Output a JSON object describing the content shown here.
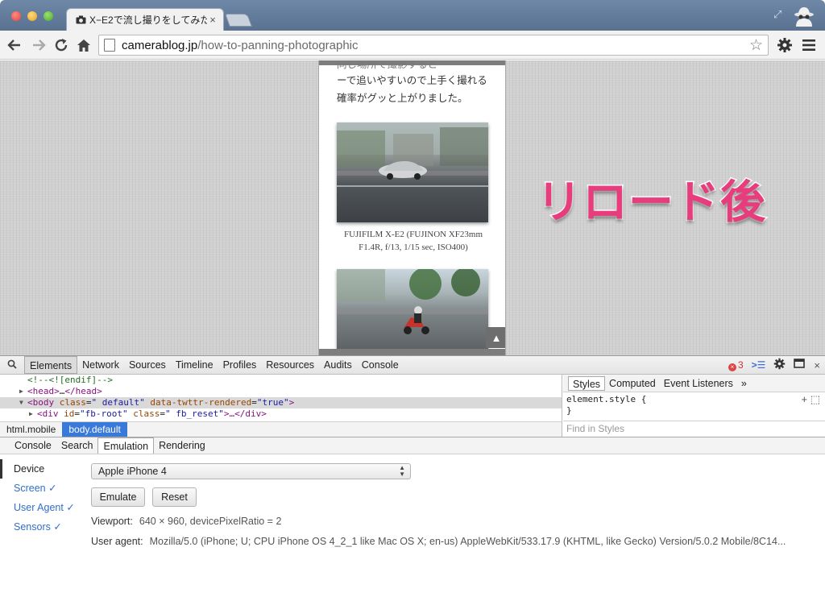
{
  "browser": {
    "tab_title": "X−E2で流し撮りをしてみた",
    "tab_close": "×",
    "url_host": "camerablog.jp",
    "url_path": "/how-to-panning-photographic"
  },
  "page": {
    "partial_line": "同じ場所で撮影すると",
    "line1": "ーで追いやすいので上手く撮れる",
    "line2": "確率がグッと上がりました。",
    "caption_line1": "FUJIFILM X-E2 (FUJINON XF23mm",
    "caption_line2": "F1.4R, f/13, 1/15 sec, ISO400)",
    "scroll_top_glyph": "▲"
  },
  "overlay": {
    "text": "リロード後",
    "color": "#e83c7d"
  },
  "devtools": {
    "tabs": [
      "Elements",
      "Network",
      "Sources",
      "Timeline",
      "Profiles",
      "Resources",
      "Audits",
      "Console"
    ],
    "active_tab": "Elements",
    "error_count": "3",
    "dom": {
      "comment": "<!--<![endif]-->",
      "head_open": "<head>",
      "head_ellipsis": "…",
      "head_close": "</head>",
      "body_tag": "<body",
      "body_attr1": "class",
      "body_val1": "\" default\"",
      "body_attr2": "data-twttr-rendered",
      "body_val2": "\"true\"",
      "body_end": ">",
      "div_tag": "<div",
      "div_attr1": "id",
      "div_val1": "\"fb-root\"",
      "div_attr2": "class",
      "div_val2": "\" fb_reset\"",
      "div_end": ">…</div>"
    },
    "breadcrumbs": [
      "html.mobile",
      "body.default"
    ],
    "styles_tabs": [
      "Styles",
      "Computed",
      "Event Listeners",
      "»"
    ],
    "element_style": "element.style {",
    "close_brace": "}",
    "find_in_styles": "Find in Styles",
    "drawer_tabs": [
      "Console",
      "Search",
      "Emulation",
      "Rendering"
    ],
    "emulation": {
      "nav": [
        "Device",
        "Screen ✓",
        "User Agent ✓",
        "Sensors ✓"
      ],
      "device_select": "Apple iPhone 4",
      "emulate_label": "Emulate",
      "reset_label": "Reset",
      "viewport_label": "Viewport:",
      "viewport_value": "640 × 960, devicePixelRatio = 2",
      "ua_label": "User agent:",
      "ua_value": "Mozilla/5.0 (iPhone; U; CPU iPhone OS 4_2_1 like Mac OS X; en-us) AppleWebKit/533.17.9 (KHTML, like Gecko) Version/5.0.2 Mobile/8C14..."
    }
  }
}
